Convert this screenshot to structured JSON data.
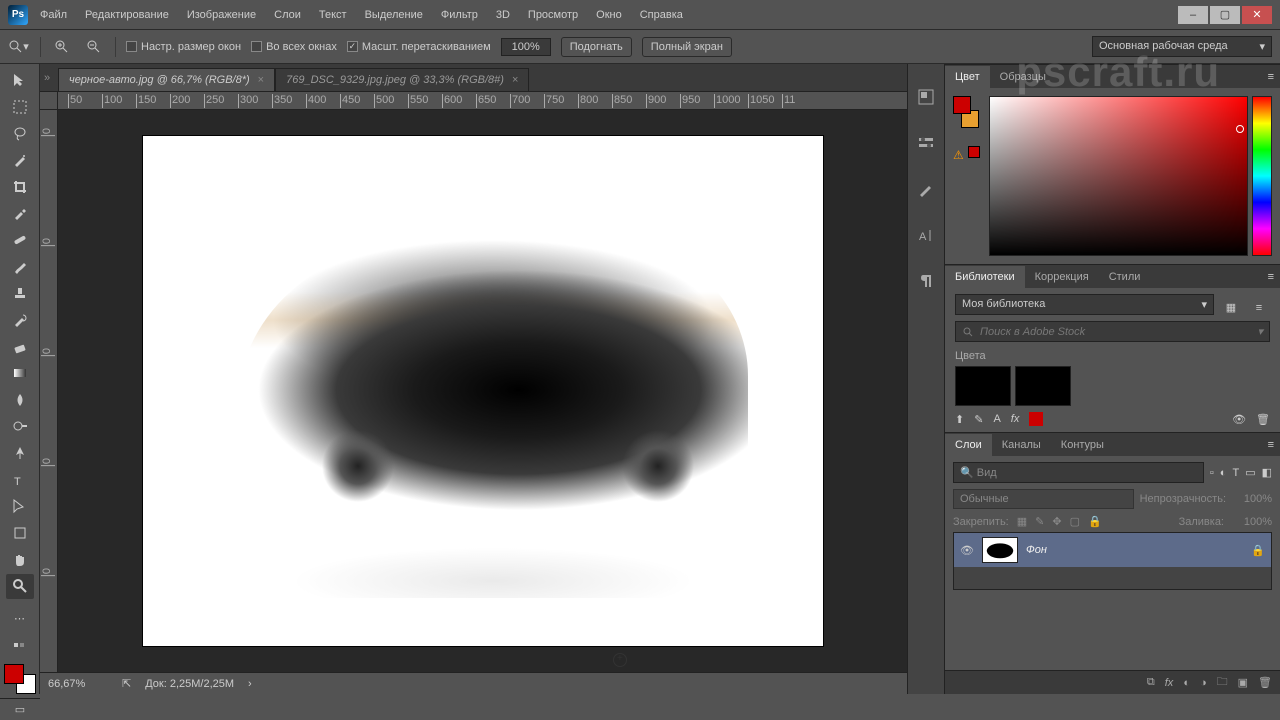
{
  "menu": [
    "Файл",
    "Редактирование",
    "Изображение",
    "Слои",
    "Текст",
    "Выделение",
    "Фильтр",
    "3D",
    "Просмотр",
    "Окно",
    "Справка"
  ],
  "optbar": {
    "chk1": "Настр. размер окон",
    "chk2": "Во всех окнах",
    "chk3": "Масшт. перетаскиванием",
    "zoom": "100%",
    "fit": "Подогнать",
    "full": "Полный экран",
    "workspace": "Основная рабочая среда"
  },
  "docs": [
    {
      "title": "черное-авто.jpg @ 66,7% (RGB/8*)",
      "active": true
    },
    {
      "title": "769_DSC_9329.jpg.jpeg @ 33,3% (RGB/8#)",
      "active": false
    }
  ],
  "rulerH": [
    "50",
    "100",
    "150",
    "200",
    "250",
    "300",
    "350",
    "400",
    "450",
    "500",
    "550",
    "600",
    "650",
    "700",
    "750",
    "800",
    "850",
    "900",
    "950",
    "1000",
    "1050",
    "11"
  ],
  "rulerHStart": 70,
  "rulerV": [
    "0",
    "0",
    "0",
    "0",
    "0"
  ],
  "status": {
    "zoom": "66,67%",
    "doc": "Док: 2,25M/2,25M"
  },
  "panel": {
    "color": {
      "tabs": [
        "Цвет",
        "Образцы"
      ],
      "active": 0
    },
    "lib": {
      "tabs": [
        "Библиотеки",
        "Коррекция",
        "Стили"
      ],
      "dd": "Моя библиотека",
      "search": "Поиск в Adobe Stock",
      "section": "Цвета"
    },
    "layers": {
      "tabs": [
        "Слои",
        "Каналы",
        "Контуры"
      ],
      "kind": "Вид",
      "mode": "Обычные",
      "opacityLabel": "Непрозрачность:",
      "opacity": "100%",
      "lockLabel": "Закрепить:",
      "fillLabel": "Заливка:",
      "fill": "100%",
      "layerName": "Фон"
    }
  },
  "watermark": "pscraft.ru"
}
